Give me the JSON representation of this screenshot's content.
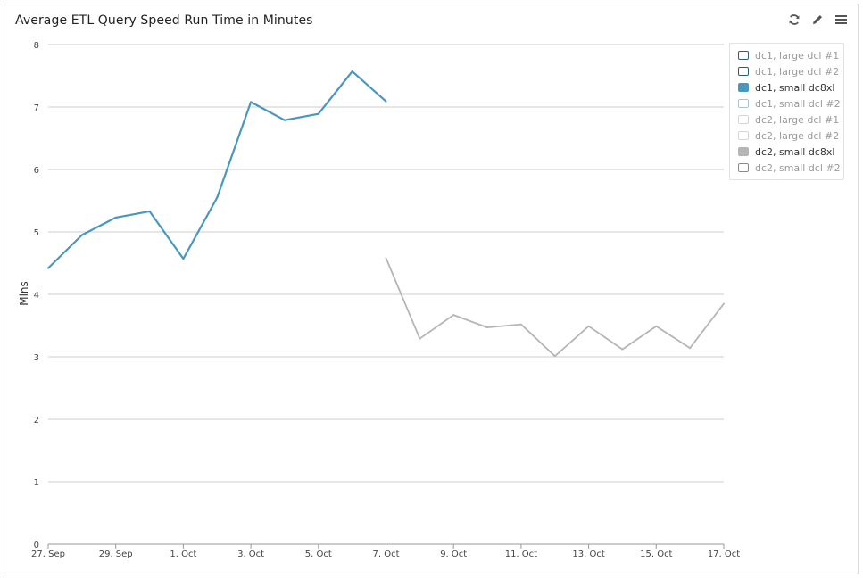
{
  "widget": {
    "title": "Average ETL Query Speed Run Time in Minutes",
    "toolbar": {
      "refresh_icon": "refresh-icon",
      "edit_icon": "pencil-icon",
      "menu_icon": "hamburger-menu-icon"
    }
  },
  "chart_data": {
    "type": "line",
    "title": "Average ETL Query Speed Run Time in Minutes",
    "xlabel": "",
    "ylabel": "Mins",
    "ylim": [
      0,
      8
    ],
    "yticks": [
      0,
      1,
      2,
      3,
      4,
      5,
      6,
      7,
      8
    ],
    "xlim": [
      "2017-09-27",
      "2017-10-17"
    ],
    "xticks": [
      {
        "date": "2017-09-27",
        "label": "27. Sep"
      },
      {
        "date": "2017-09-29",
        "label": "29. Sep"
      },
      {
        "date": "2017-10-01",
        "label": "1. Oct"
      },
      {
        "date": "2017-10-03",
        "label": "3. Oct"
      },
      {
        "date": "2017-10-05",
        "label": "5. Oct"
      },
      {
        "date": "2017-10-07",
        "label": "7. Oct"
      },
      {
        "date": "2017-10-09",
        "label": "9. Oct"
      },
      {
        "date": "2017-10-11",
        "label": "11. Oct"
      },
      {
        "date": "2017-10-13",
        "label": "13. Oct"
      },
      {
        "date": "2017-10-15",
        "label": "15. Oct"
      },
      {
        "date": "2017-10-17",
        "label": "17. Oct"
      }
    ],
    "grid": true,
    "legend_position": "top-right",
    "series": [
      {
        "name": "dc1, small dc8xl",
        "color": "#4a97be",
        "x": [
          "2017-09-27",
          "2017-09-28",
          "2017-09-29",
          "2017-09-30",
          "2017-10-01",
          "2017-10-02",
          "2017-10-03",
          "2017-10-04",
          "2017-10-05",
          "2017-10-06",
          "2017-10-07"
        ],
        "values": [
          4.42,
          4.95,
          5.23,
          5.33,
          4.57,
          5.55,
          7.08,
          6.79,
          6.89,
          7.57,
          7.09
        ]
      },
      {
        "name": "dc2, small dc8xl",
        "color": "#b5b5b5",
        "x": [
          "2017-10-07",
          "2017-10-08",
          "2017-10-09",
          "2017-10-10",
          "2017-10-11",
          "2017-10-12",
          "2017-10-13",
          "2017-10-14",
          "2017-10-15",
          "2017-10-16",
          "2017-10-17"
        ],
        "values": [
          4.58,
          3.29,
          3.67,
          3.47,
          3.52,
          3.01,
          3.49,
          3.12,
          3.49,
          3.14,
          3.85
        ]
      }
    ]
  },
  "legend": {
    "items": [
      {
        "label": "dc1, large dcl #1",
        "swatch_fill": "#ffffff",
        "swatch_border": "#2d5f7c",
        "text_color": "#9a9a9a"
      },
      {
        "label": "dc1, large dcl #2",
        "swatch_fill": "#ffffff",
        "swatch_border": "#2d5f7c",
        "text_color": "#9a9a9a"
      },
      {
        "label": "dc1, small dc8xl",
        "swatch_fill": "#4a97be",
        "swatch_border": "#4a97be",
        "text_color": "#333333"
      },
      {
        "label": "dc1, small dcl #2",
        "swatch_fill": "#ffffff",
        "swatch_border": "#a9c3d6",
        "text_color": "#9a9a9a"
      },
      {
        "label": "dc2, large dcl #1",
        "swatch_fill": "#ffffff",
        "swatch_border": "#d6d6d6",
        "text_color": "#9a9a9a"
      },
      {
        "label": "dc2, large dcl #2",
        "swatch_fill": "#ffffff",
        "swatch_border": "#d6d6d6",
        "text_color": "#9a9a9a"
      },
      {
        "label": "dc2, small dc8xl",
        "swatch_fill": "#b5b5b5",
        "swatch_border": "#b5b5b5",
        "text_color": "#333333"
      },
      {
        "label": "dc2, small dcl #2",
        "swatch_fill": "#ffffff",
        "swatch_border": "#8a8a8a",
        "text_color": "#9a9a9a"
      }
    ]
  }
}
